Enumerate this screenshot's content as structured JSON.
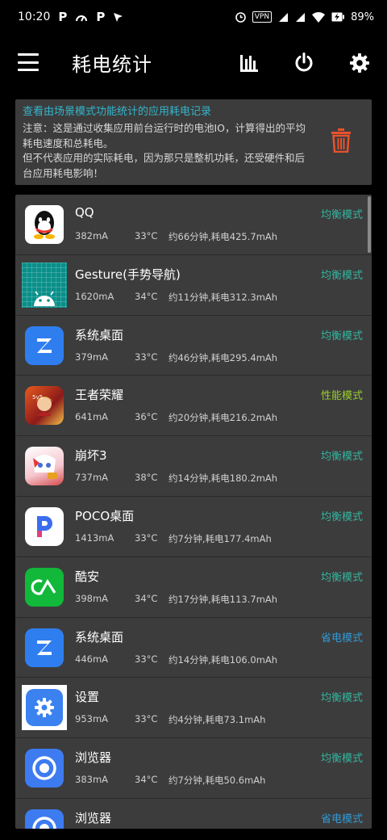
{
  "status": {
    "time": "10:20",
    "vpn": "VPN",
    "battery": "89%"
  },
  "app_bar": {
    "title": "耗电统计"
  },
  "notice": {
    "link": "查看由场景模式功能统计的应用耗电记录",
    "line1": "注意：这是通过收集应用前台运行时的电池IO，计算得出的平均耗电速度和总耗电。",
    "line2": "但不代表应用的实际耗电，因为那只是整机功耗，还受硬件和后台应用耗电影响！"
  },
  "colors": {
    "balanced": "#33b6a0",
    "performance": "#9acd32",
    "powersave": "#2f9ad6",
    "trash": "#e8522e"
  },
  "apps": [
    {
      "name": "QQ",
      "mode": "均衡模式",
      "mode_type": "balanced",
      "current": "382mA",
      "temp": "33°C",
      "usage": "约66分钟,耗电425.7mAh",
      "icon": "qq-icon"
    },
    {
      "name": "Gesture(手势导航)",
      "mode": "均衡模式",
      "mode_type": "balanced",
      "current": "1620mA",
      "temp": "34°C",
      "usage": "约11分钟,耗电312.3mAh",
      "icon": "android-icon"
    },
    {
      "name": "系统桌面",
      "mode": "均衡模式",
      "mode_type": "balanced",
      "current": "379mA",
      "temp": "33°C",
      "usage": "约46分钟,耗电295.4mAh",
      "icon": "launcher-icon"
    },
    {
      "name": "王者荣耀",
      "mode": "性能模式",
      "mode_type": "performance",
      "current": "641mA",
      "temp": "36°C",
      "usage": "约20分钟,耗电216.2mAh",
      "icon": "game-icon"
    },
    {
      "name": "崩坏3",
      "mode": "均衡模式",
      "mode_type": "balanced",
      "current": "737mA",
      "temp": "38°C",
      "usage": "约14分钟,耗电180.2mAh",
      "icon": "anime-game-icon"
    },
    {
      "name": "POCO桌面",
      "mode": "均衡模式",
      "mode_type": "balanced",
      "current": "1413mA",
      "temp": "33°C",
      "usage": "约7分钟,耗电177.4mAh",
      "icon": "poco-icon"
    },
    {
      "name": "酷安",
      "mode": "均衡模式",
      "mode_type": "balanced",
      "current": "398mA",
      "temp": "34°C",
      "usage": "约17分钟,耗电113.7mAh",
      "icon": "coolapk-icon"
    },
    {
      "name": "系统桌面",
      "mode": "省电模式",
      "mode_type": "powersave",
      "current": "446mA",
      "temp": "33°C",
      "usage": "约14分钟,耗电106.0mAh",
      "icon": "launcher-icon"
    },
    {
      "name": "设置",
      "mode": "均衡模式",
      "mode_type": "balanced",
      "current": "953mA",
      "temp": "33°C",
      "usage": "约4分钟,耗电73.1mAh",
      "icon": "settings-icon"
    },
    {
      "name": "浏览器",
      "mode": "均衡模式",
      "mode_type": "balanced",
      "current": "383mA",
      "temp": "34°C",
      "usage": "约7分钟,耗电50.6mAh",
      "icon": "browser-icon"
    },
    {
      "name": "浏览器",
      "mode": "省电模式",
      "mode_type": "powersave",
      "current": "",
      "temp": "",
      "usage": "",
      "icon": "browser-icon"
    }
  ]
}
